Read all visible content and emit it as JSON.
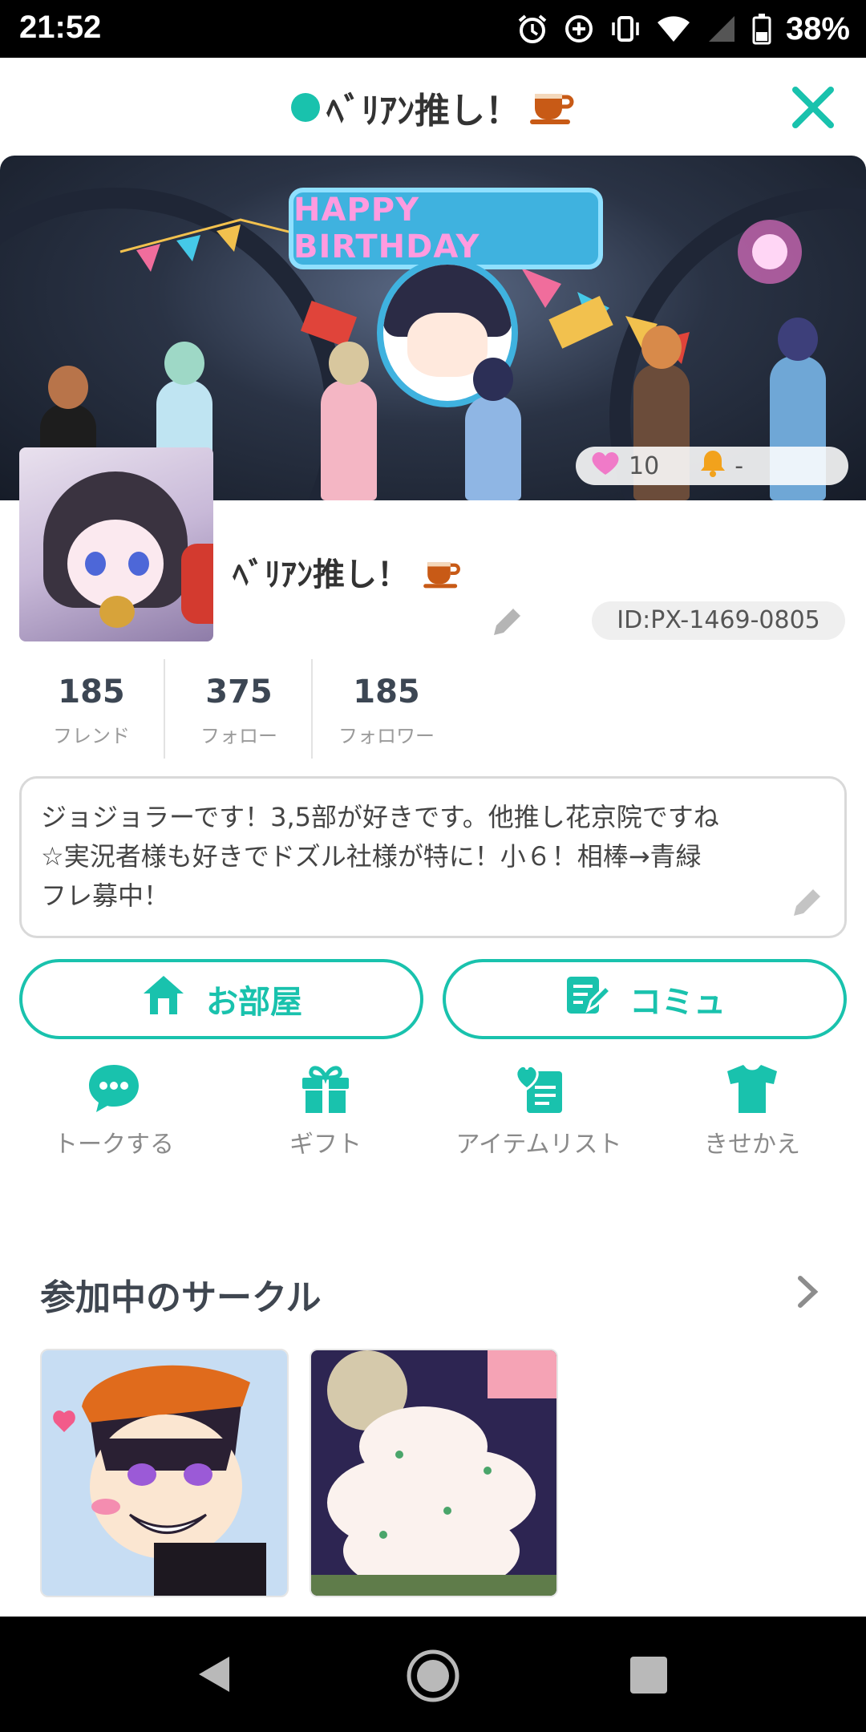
{
  "status_bar": {
    "time": "21:52",
    "battery": "38%"
  },
  "header": {
    "title": "ﾍﾞﾘｱﾝ推し！",
    "title_emoji": "☕"
  },
  "banner": {
    "ribbon_text": "HAPPY BIRTHDAY",
    "likes": "10",
    "bell": "-"
  },
  "profile": {
    "username": "ﾍﾞﾘｱﾝ推し！",
    "username_emoji": "☕",
    "id_text": "ID:PX-1469-0805"
  },
  "counts": [
    {
      "value": "185",
      "label": "フレンド"
    },
    {
      "value": "375",
      "label": "フォロー"
    },
    {
      "value": "185",
      "label": "フォロワー"
    }
  ],
  "bio": {
    "line1": "ジョジョラーです！3,5部が好きです。他推し花京院ですね",
    "line2": "☆実況者様も好きでドズル社様が特に！小６！相棒→青緑",
    "line3": "フレ募中！"
  },
  "actions": {
    "room": "お部屋",
    "community": "コミュ"
  },
  "menu": [
    {
      "label": "トークする",
      "icon": "chat-bubble-icon"
    },
    {
      "label": "ギフト",
      "icon": "gift-icon"
    },
    {
      "label": "アイテムリスト",
      "icon": "item-list-icon"
    },
    {
      "label": "きせかえ",
      "icon": "tshirt-icon"
    }
  ],
  "circles": {
    "title": "参加中のサークル"
  },
  "colors": {
    "accent": "#19c2ad",
    "text": "#3a3a3a"
  }
}
